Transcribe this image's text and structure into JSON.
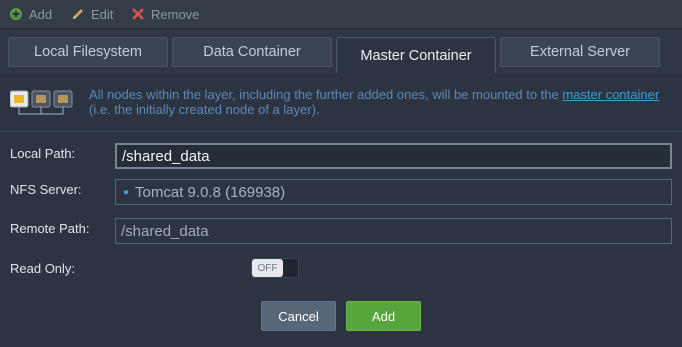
{
  "toolbar": {
    "add_label": "Add",
    "edit_label": "Edit",
    "remove_label": "Remove",
    "add_icon": "plus-circle-icon",
    "edit_icon": "pencil-icon",
    "remove_icon": "x-icon"
  },
  "tabs": [
    {
      "label": "Local Filesystem",
      "active": false
    },
    {
      "label": "Data Container",
      "active": false
    },
    {
      "label": "Master Container",
      "active": true
    },
    {
      "label": "External Server",
      "active": false
    }
  ],
  "info": {
    "text_before": "All nodes within the layer, including the further added ones, will be mounted to the ",
    "link_text": "master container",
    "text_after": "(i.e. the initially created node of a layer)."
  },
  "form": {
    "local_path_label": "Local Path:",
    "local_path_value": "/shared_data",
    "nfs_server_label": "NFS Server:",
    "nfs_server_value": "Tomcat 9.0.8 (169938)",
    "remote_path_label": "Remote Path:",
    "remote_path_value": "/shared_data",
    "read_only_label": "Read Only:",
    "read_only_toggle": "OFF"
  },
  "buttons": {
    "cancel_label": "Cancel",
    "add_label": "Add"
  },
  "colors": {
    "accent_link": "#3d9bdc",
    "add_green": "#57a63c",
    "remove_red": "#d9534f"
  }
}
